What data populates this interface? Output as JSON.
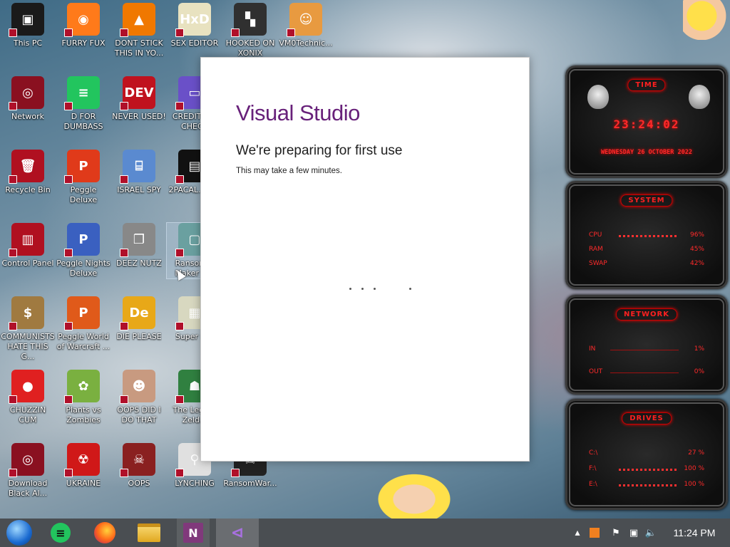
{
  "desktop": {
    "icons": [
      {
        "label": "This PC",
        "col": 0,
        "row": 0,
        "bg": "#1a1a1a",
        "glyph": "▣",
        "name": "this-pc-icon"
      },
      {
        "label": "FURRY FUX",
        "col": 1,
        "row": 0,
        "bg": "#ff7a1a",
        "glyph": "◉",
        "name": "firefox-icon"
      },
      {
        "label": "DONT STICK THIS IN YO...",
        "col": 2,
        "row": 0,
        "bg": "#f07800",
        "glyph": "▲",
        "name": "vlc-cone-icon"
      },
      {
        "label": "SEX EDITOR",
        "col": 3,
        "row": 0,
        "bg": "#e8e2c0",
        "glyph": "HxD",
        "name": "hex-editor-icon"
      },
      {
        "label": "HOOKED ON XONIX",
        "col": 4,
        "row": 0,
        "bg": "#303030",
        "glyph": "▚",
        "name": "xonix-icon"
      },
      {
        "label": "VM0Technic...",
        "col": 5,
        "row": 0,
        "bg": "#e89a40",
        "glyph": "☺",
        "name": "technician-icon"
      },
      {
        "label": "Network",
        "col": 0,
        "row": 1,
        "bg": "#8a1020",
        "glyph": "◎",
        "name": "network-icon"
      },
      {
        "label": "D FOR DUMBASS",
        "col": 1,
        "row": 1,
        "bg": "#22c55e",
        "glyph": "≡",
        "name": "spotify-icon"
      },
      {
        "label": "NEVER USED!",
        "col": 2,
        "row": 1,
        "bg": "#c0121e",
        "glyph": "DEV",
        "name": "devcpp-icon"
      },
      {
        "label": "CREDIT C... CHECK",
        "col": 3,
        "row": 1,
        "bg": "#6a50c8",
        "glyph": "▭",
        "name": "credit-card-icon"
      },
      {
        "label": "Recycle Bin",
        "col": 0,
        "row": 2,
        "bg": "#b01020",
        "glyph": "🗑",
        "name": "recycle-bin-icon"
      },
      {
        "label": "Peggle Deluxe",
        "col": 1,
        "row": 2,
        "bg": "#e03a1a",
        "glyph": "P",
        "name": "peggle-icon"
      },
      {
        "label": "ISRAEL SPY",
        "col": 2,
        "row": 2,
        "bg": "#5a8ad0",
        "glyph": "⌸",
        "name": "spy-icon"
      },
      {
        "label": "2PACAL... 2.3",
        "col": 3,
        "row": 2,
        "bg": "#111",
        "glyph": "▤",
        "name": "terminal-icon"
      },
      {
        "label": "Control Panel",
        "col": 0,
        "row": 3,
        "bg": "#b01020",
        "glyph": "▥",
        "name": "control-panel-icon"
      },
      {
        "label": "Peggle Nights Deluxe",
        "col": 1,
        "row": 3,
        "bg": "#3a60c0",
        "glyph": "P",
        "name": "peggle-nights-icon"
      },
      {
        "label": "DEEZ NUTZ",
        "col": 2,
        "row": 3,
        "bg": "#888",
        "glyph": "❐",
        "name": "deez-nutz-icon"
      },
      {
        "label": "Ransom... Maker B...",
        "col": 3,
        "row": 3,
        "bg": "#6aa0a0",
        "glyph": "▢",
        "name": "ransom-maker-icon"
      },
      {
        "label": "COMMUNISTS HATE THIS G...",
        "col": 0,
        "row": 4,
        "bg": "#a07a40",
        "glyph": "$",
        "name": "money-bag-icon"
      },
      {
        "label": "Peggle World of Warcraft ...",
        "col": 1,
        "row": 4,
        "bg": "#e05a1a",
        "glyph": "P",
        "name": "peggle-wow-icon"
      },
      {
        "label": "DIE PLEASE",
        "col": 2,
        "row": 4,
        "bg": "#e8a818",
        "glyph": "De",
        "name": "die-please-icon"
      },
      {
        "label": "Super H...",
        "col": 3,
        "row": 4,
        "bg": "#d8d8c0",
        "glyph": "▦",
        "name": "super-icon"
      },
      {
        "label": "CHUZZIN CUM",
        "col": 0,
        "row": 5,
        "bg": "#e02020",
        "glyph": "●",
        "name": "chuzzle-icon"
      },
      {
        "label": "Plants vs Zombies",
        "col": 1,
        "row": 5,
        "bg": "#7ab040",
        "glyph": "✿",
        "name": "plants-vs-zombies-icon"
      },
      {
        "label": "OOPS DID I DO THAT",
        "col": 2,
        "row": 5,
        "bg": "#c89a80",
        "glyph": "☻",
        "name": "portrait-icon"
      },
      {
        "label": "The Lege... Zeld...",
        "col": 3,
        "row": 5,
        "bg": "#308040",
        "glyph": "☗",
        "name": "zelda-icon"
      },
      {
        "label": "Download Black Al...",
        "col": 0,
        "row": 6,
        "bg": "#8a1020",
        "glyph": "◎",
        "name": "black-alien-icon"
      },
      {
        "label": "UKRAINE",
        "col": 1,
        "row": 6,
        "bg": "#d01818",
        "glyph": "☢",
        "name": "radiation-icon"
      },
      {
        "label": "OOPS",
        "col": 2,
        "row": 6,
        "bg": "#8a2020",
        "glyph": "☠",
        "name": "oops-icon"
      },
      {
        "label": "LYNCHING",
        "col": 3,
        "row": 6,
        "bg": "#e0e0e0",
        "glyph": "⚲",
        "name": "lynching-icon"
      },
      {
        "label": "RansomWar...",
        "col": 4,
        "row": 6,
        "bg": "#222",
        "glyph": "☠",
        "name": "ransomware-icon"
      }
    ]
  },
  "vs_window": {
    "brand": "Visual Studio",
    "heading": "We're preparing for first use",
    "subtext": "This may take a few minutes."
  },
  "gadgets": {
    "time": {
      "title": "TIME",
      "clock": "23:24:02",
      "date": "WEDNESDAY 26 OCTOBER 2022"
    },
    "system": {
      "title": "SYSTEM",
      "rows": [
        {
          "k": "CPU",
          "v": "96%",
          "level": 0.96
        },
        {
          "k": "RAM",
          "v": "45%",
          "level": 0.45
        },
        {
          "k": "SWAP",
          "v": "42%",
          "level": 0.42
        }
      ]
    },
    "network": {
      "title": "NETWORK",
      "rows": [
        {
          "k": "IN",
          "v": "1%"
        },
        {
          "k": "OUT",
          "v": "0%"
        }
      ]
    },
    "drives": {
      "title": "DRIVES",
      "rows": [
        {
          "k": "C:\\",
          "v": "27 %",
          "level": 0.27
        },
        {
          "k": "F:\\",
          "v": "100 %",
          "level": 1.0
        },
        {
          "k": "E:\\",
          "v": "100 %",
          "level": 1.0
        }
      ]
    }
  },
  "taskbar": {
    "clock": "11:24 PM",
    "apps": [
      "start",
      "spotify",
      "firefox",
      "file-explorer",
      "onenote",
      "visual-studio"
    ],
    "active": "visual-studio"
  }
}
